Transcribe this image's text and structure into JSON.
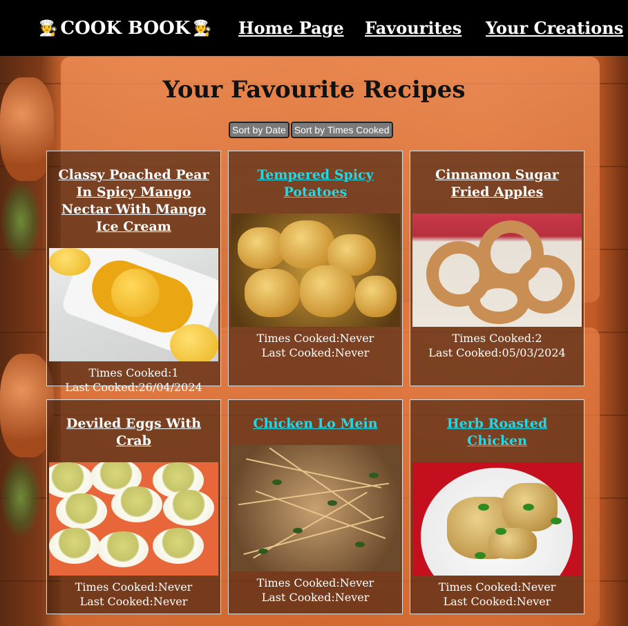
{
  "app": {
    "brand": "COOK BOOK",
    "brand_icon": "chef-emoji"
  },
  "nav": {
    "home": "Home Page",
    "favourites": "Favourites",
    "creations": "Your Creations"
  },
  "page": {
    "title": "Your Favourite Recipes",
    "sort_by_date": "Sort by Date",
    "sort_by_times": "Sort by Times Cooked"
  },
  "labels": {
    "times_cooked": "Times Cooked:",
    "last_cooked": "Last Cooked:"
  },
  "recipes": [
    {
      "title": "Classy Poached Pear In Spicy Mango Nectar With Mango Ice Cream",
      "times": "1",
      "last": "26/04/2024",
      "visited": false
    },
    {
      "title": "Tempered Spicy Potatoes",
      "times": "Never",
      "last": "Never",
      "visited": true
    },
    {
      "title": "Cinnamon Sugar Fried Apples",
      "times": "2",
      "last": "05/03/2024",
      "visited": false
    },
    {
      "title": "Deviled Eggs With Crab",
      "times": "Never",
      "last": "Never",
      "visited": false
    },
    {
      "title": "Chicken Lo Mein",
      "times": "Never",
      "last": "Never",
      "visited": true
    },
    {
      "title": "Herb Roasted Chicken",
      "times": "Never",
      "last": "Never",
      "visited": true
    }
  ],
  "colors": {
    "header_bg": "#000000",
    "link_visited": "#27d7e4",
    "link": "#ffffff"
  }
}
